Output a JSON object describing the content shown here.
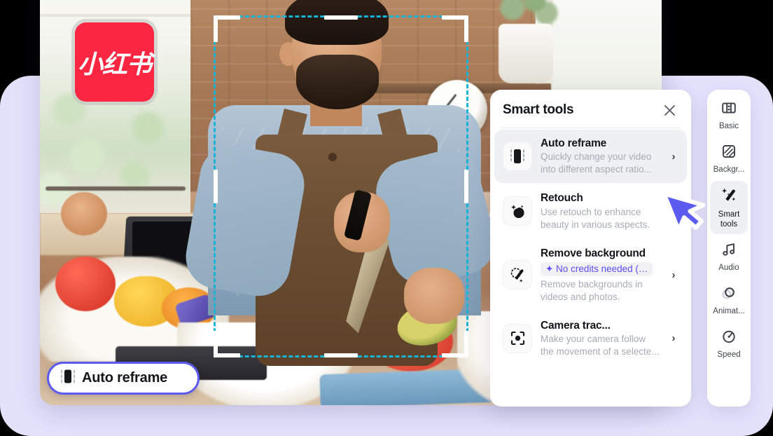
{
  "app": {
    "brand_logo_text": "小红书",
    "accent_purple": "#5b5bf0",
    "selection_color": "#18b4d8",
    "badge_text_color": "#5b4df0"
  },
  "canvas": {
    "auto_reframe_pill": {
      "label": "Auto reframe",
      "icon": "phone-frame-icon"
    },
    "crop_selection": {
      "name": "crop-selection-box"
    }
  },
  "smart_tools_panel": {
    "title": "Smart tools",
    "close_icon": "close-icon",
    "items": [
      {
        "name": "Auto reframe",
        "desc": "Quickly change your video into different aspect ratio...",
        "icon": "phone-frame-icon",
        "chevron": "›",
        "selected": true,
        "badge": null
      },
      {
        "name": "Retouch",
        "desc": "Use retouch to enhance beauty in various aspects.",
        "icon": "retouch-sparkle-icon",
        "chevron": "›",
        "selected": false,
        "badge": null
      },
      {
        "name": "Remove background",
        "desc": "Remove backgrounds in videos and photos.",
        "icon": "magic-wand-icon",
        "chevron": "›",
        "selected": false,
        "badge": "✦ No credits needed (…"
      },
      {
        "name": "Camera trac...",
        "desc": "Make your camera follow the movement of a selecte...",
        "icon": "camera-tracking-icon",
        "chevron": "›",
        "selected": false,
        "badge": null
      }
    ]
  },
  "right_rail": {
    "items": [
      {
        "label": "Basic",
        "icon": "film-strip-icon",
        "active": false
      },
      {
        "label": "Backgr...",
        "icon": "hatched-square-icon",
        "active": false
      },
      {
        "label": "Smart\ntools",
        "icon": "magic-wand-icon",
        "active": true
      },
      {
        "label": "Audio",
        "icon": "music-note-icon",
        "active": false
      },
      {
        "label": "Animat...",
        "icon": "animation-rings-icon",
        "active": false
      },
      {
        "label": "Speed",
        "icon": "speedometer-icon",
        "active": false
      }
    ]
  },
  "cursor": {
    "name": "mouse-pointer"
  }
}
